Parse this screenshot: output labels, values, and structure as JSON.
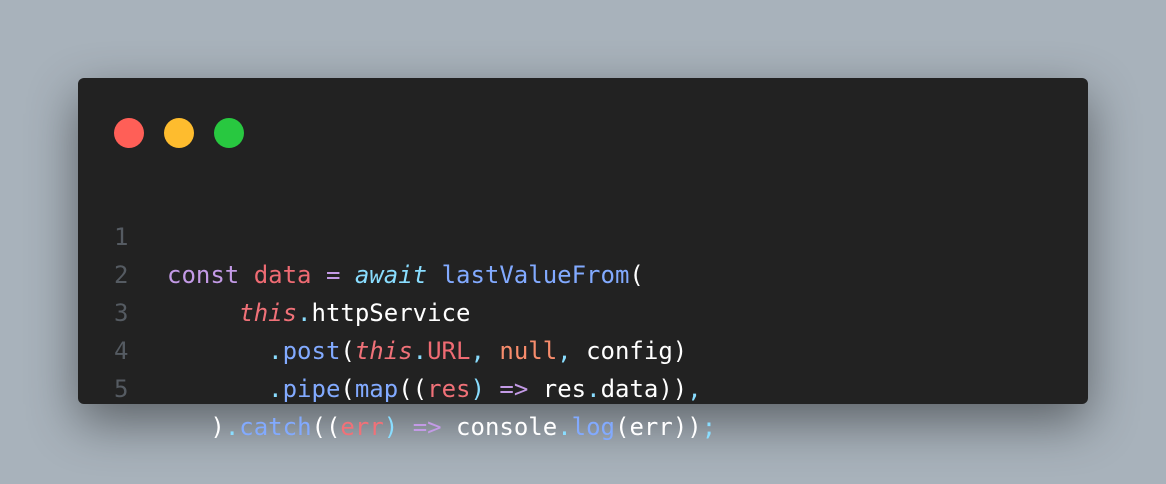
{
  "window_controls": {
    "close_color": "#ff5f57",
    "minimize_color": "#febc2e",
    "maximize_color": "#28c840"
  },
  "code_lines": [
    {
      "number": "1",
      "tokens": {
        "t1": "const",
        "t2": " ",
        "t3": "data",
        "t4": " ",
        "t5": "=",
        "t6": " ",
        "t7": "await",
        "t8": " ",
        "t9": "lastValueFrom",
        "t10": "("
      }
    },
    {
      "number": "2",
      "tokens": {
        "indent": "     ",
        "t1": "this",
        "t2": ".",
        "t3": "httpService"
      }
    },
    {
      "number": "3",
      "tokens": {
        "indent": "       ",
        "t1": ".",
        "t2": "post",
        "t3": "(",
        "t4": "this",
        "t5": ".",
        "t6": "URL",
        "t7": ",",
        "t8": " ",
        "t9": "null",
        "t10": ",",
        "t11": " ",
        "t12": "config",
        "t13": ")"
      }
    },
    {
      "number": "4",
      "tokens": {
        "indent": "       ",
        "t1": ".",
        "t2": "pipe",
        "t3": "(",
        "t4": "map",
        "t5": "((",
        "t6": "res",
        "t7": ")",
        "t8": " ",
        "t9": "=>",
        "t10": " ",
        "t11": "res",
        "t12": ".",
        "t13": "data",
        "t14": "))",
        "t15": ","
      }
    },
    {
      "number": "5",
      "tokens": {
        "indent": "   ",
        "t1": ")",
        "t2": ".",
        "t3": "catch",
        "t4": "((",
        "t5": "err",
        "t6": ")",
        "t7": " ",
        "t8": "=>",
        "t9": " ",
        "t10": "console",
        "t11": ".",
        "t12": "log",
        "t13": "(",
        "t14": "err",
        "t15": "))",
        "t16": ";"
      }
    }
  ]
}
